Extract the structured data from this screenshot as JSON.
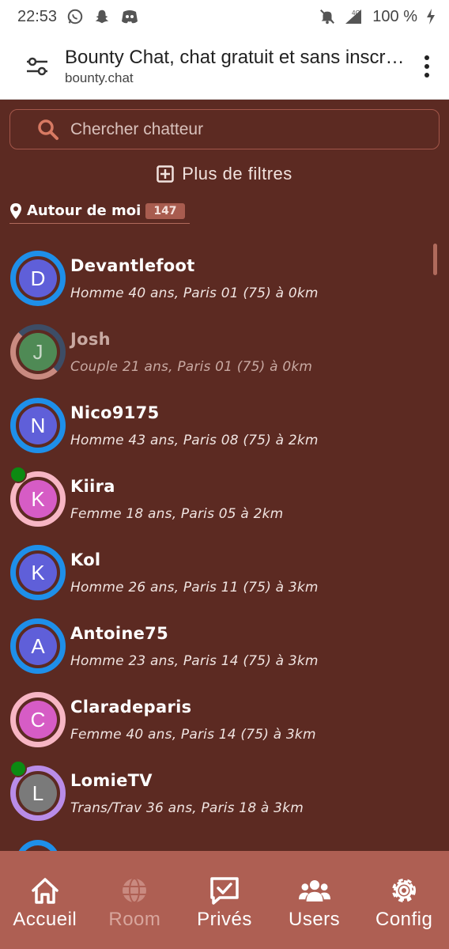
{
  "status_bar": {
    "time": "22:53",
    "battery": "100 %",
    "network": "4G",
    "icons": [
      "whatsapp-icon",
      "snapchat-icon",
      "discord-icon",
      "mute-icon",
      "signal-icon",
      "charging-icon"
    ]
  },
  "browser": {
    "title": "Bounty Chat, chat gratuit et sans inscription",
    "url": "bounty.chat"
  },
  "search": {
    "placeholder": "Chercher chatteur"
  },
  "filters": {
    "label": "Plus de filtres"
  },
  "around": {
    "label": "Autour de moi",
    "count": "147"
  },
  "users": [
    {
      "initial": "D",
      "name": "Devantlefoot",
      "info": "Homme 40 ans, Paris 01 (75) à 0km",
      "ring": "#1e8fe9",
      "bg": "#5f5fd9",
      "online": false,
      "dim": false
    },
    {
      "initial": "J",
      "name": "Josh",
      "info": "Couple 21 ans, Paris 01 (75) à 0km",
      "ring": "split",
      "bg": "#4f8a55",
      "online": false,
      "dim": true
    },
    {
      "initial": "N",
      "name": "Nico9175",
      "info": "Homme 43 ans, Paris 08 (75) à 2km",
      "ring": "#1e8fe9",
      "bg": "#5f5fd9",
      "online": false,
      "dim": false
    },
    {
      "initial": "K",
      "name": "Kiira",
      "info": "Femme 18 ans, Paris 05 à 2km",
      "ring": "#f7b6c4",
      "bg": "#d65cc5",
      "online": true,
      "dim": false
    },
    {
      "initial": "K",
      "name": "Kol",
      "info": "Homme 26 ans, Paris 11 (75) à 3km",
      "ring": "#1e8fe9",
      "bg": "#5f5fd9",
      "online": false,
      "dim": false
    },
    {
      "initial": "A",
      "name": "Antoine75",
      "info": "Homme 23 ans, Paris 14 (75) à 3km",
      "ring": "#1e8fe9",
      "bg": "#5f5fd9",
      "online": false,
      "dim": false
    },
    {
      "initial": "C",
      "name": "Claradeparis",
      "info": "Femme 40 ans, Paris 14 (75) à 3km",
      "ring": "#f7b6c4",
      "bg": "#d65cc5",
      "online": false,
      "dim": false
    },
    {
      "initial": "L",
      "name": "LomieTV",
      "info": "Trans/Trav 36 ans, Paris 18 à 3km",
      "ring": "#b98ce8",
      "bg": "#7a7a7a",
      "online": true,
      "dim": false
    }
  ],
  "nav": [
    {
      "id": "accueil",
      "label": "Accueil",
      "icon": "home-icon",
      "disabled": false
    },
    {
      "id": "room",
      "label": "Room",
      "icon": "globe-icon",
      "disabled": true
    },
    {
      "id": "prives",
      "label": "Privés",
      "icon": "message-check-icon",
      "disabled": false
    },
    {
      "id": "users",
      "label": "Users",
      "icon": "users-icon",
      "disabled": false
    },
    {
      "id": "config",
      "label": "Config",
      "icon": "gear-icon",
      "disabled": false
    }
  ]
}
